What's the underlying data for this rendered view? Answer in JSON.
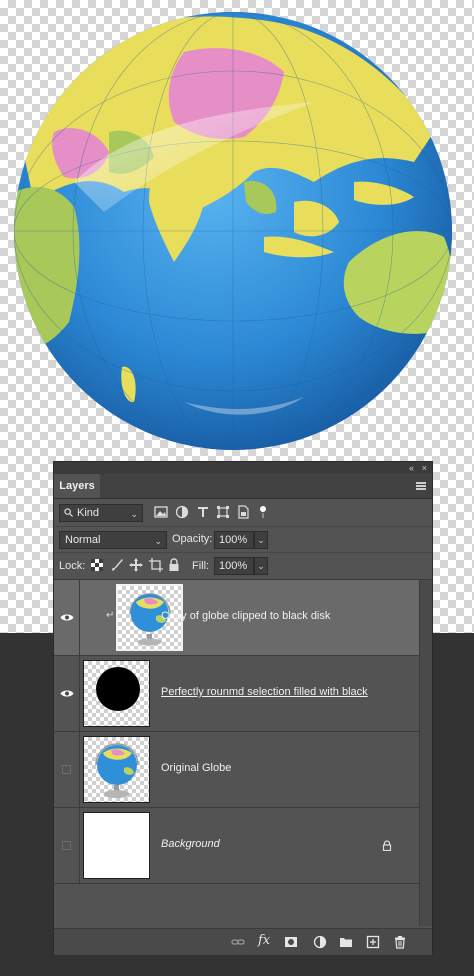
{
  "panel": {
    "tab_label": "Layers",
    "collapse_glyph": "«",
    "close_glyph": "×"
  },
  "filter": {
    "kind_label": "Kind",
    "icons": [
      "image-filter-icon",
      "adjustment-filter-icon",
      "type-filter-icon",
      "shape-filter-icon",
      "smart-object-filter-icon",
      "filter-toggle-icon"
    ]
  },
  "blend": {
    "mode": "Normal",
    "opacity_label": "Opacity:",
    "opacity_value": "100%"
  },
  "lock": {
    "label": "Lock:",
    "fill_label": "Fill:",
    "fill_value": "100%",
    "icons": [
      "lock-transparent-pixels-icon",
      "lock-image-pixels-icon",
      "lock-position-icon",
      "lock-artboard-icon",
      "lock-all-icon"
    ]
  },
  "layers": [
    {
      "name": "Copy of globe clipped to black disk",
      "visible": true,
      "selected": true,
      "clipped": true,
      "thumbnail": "globe"
    },
    {
      "name": "Perfectly rounmd selection filled with black",
      "visible": true,
      "selected": false,
      "clipped": false,
      "thumbnail": "black-disk"
    },
    {
      "name": "Original Globe",
      "visible": false,
      "selected": false,
      "clipped": false,
      "thumbnail": "globe-stand"
    },
    {
      "name": "Background",
      "visible": false,
      "selected": false,
      "clipped": false,
      "thumbnail": "white",
      "locked": true
    }
  ],
  "footer_icons": [
    "link-layers-icon",
    "fx-icon",
    "add-mask-icon",
    "adjustment-layer-icon",
    "group-folder-icon",
    "new-layer-icon",
    "trash-icon"
  ],
  "footer": {
    "fx_label": "fx"
  },
  "colors": {
    "panel_bg": "#535353",
    "selected_row": "#6a6a6a",
    "ocean": "#2f8fd8",
    "land_yellow": "#e8dc5a",
    "land_pink": "#e58fc6",
    "land_green": "#a9c85b"
  }
}
